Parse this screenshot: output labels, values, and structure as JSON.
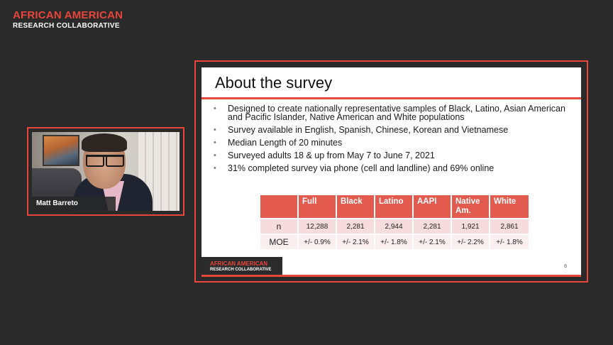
{
  "brand": {
    "line1": "AFRICAN AMERICAN",
    "line2": "RESEARCH COLLABORATIVE",
    "accent_color": "#e8453c"
  },
  "participant": {
    "name": "Matt Barreto"
  },
  "slide": {
    "title": "About the survey",
    "bullets": [
      "Designed to create nationally representative samples of Black, Latino, Asian American and Pacific Islander, Native American and White populations",
      "Survey available in English, Spanish, Chinese, Korean and Vietnamese",
      "Median Length of 20 minutes",
      "Surveyed adults 18 & up from May 7 to June 7, 2021",
      "31% completed survey via phone (cell and landline) and 69% online"
    ],
    "bullet_glyph": "•",
    "table": {
      "headers": [
        "",
        "Full",
        "Black",
        "Latino",
        "AAPI",
        "Native Am.",
        "White"
      ],
      "rows": [
        {
          "label": "n",
          "values": [
            "12,288",
            "2,281",
            "2,944",
            "2,281",
            "1,921",
            "2,861"
          ]
        },
        {
          "label": "MOE",
          "values": [
            "+/- 0.9%",
            "+/- 2.1%",
            "+/- 1.8%",
            "+/- 2.1%",
            "+/- 2.2%",
            "+/- 1.8%"
          ]
        }
      ]
    },
    "footer": {
      "line1": "AFRICAN AMERICAN",
      "line2": "RESEARCH COLLABORATIVE"
    },
    "page_number": "6"
  }
}
